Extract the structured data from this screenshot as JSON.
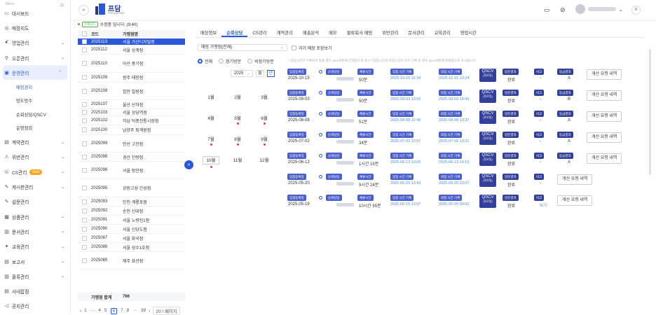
{
  "sidebar": {
    "menu_label": "Menu",
    "items": [
      {
        "label": "대시보드",
        "icon": "monitor-icon",
        "glyph": "▭",
        "chev": ""
      },
      {
        "label": "매장지도",
        "icon": "map-pin-icon",
        "glyph": "◎",
        "chev": ""
      },
      {
        "label": "영업관리",
        "icon": "people-icon",
        "glyph": "ꗃ",
        "chev": "⌄"
      },
      {
        "label": "오픈관리",
        "icon": "location-icon",
        "glyph": "⚲",
        "chev": "⌄"
      },
      {
        "label": "운영관리",
        "icon": "store-icon",
        "glyph": "▣",
        "chev": "⌃"
      }
    ],
    "sub_items": [
      "매장관리",
      "방도방수",
      "순회상담/QSCV",
      "운영점검"
    ],
    "items2": [
      {
        "label": "계약관리",
        "icon": "contract-icon",
        "glyph": "▤",
        "chev": "⌄"
      },
      {
        "label": "위반관리",
        "icon": "warning-icon",
        "glyph": "⚠",
        "chev": "⌄"
      },
      {
        "label": "CS관리",
        "icon": "cs-icon",
        "glyph": "☏",
        "chev": "⌄",
        "badge": "New"
      },
      {
        "label": "게시판관리",
        "icon": "edit-icon",
        "glyph": "✎",
        "chev": "⌄"
      },
      {
        "label": "설문관리",
        "icon": "survey-icon",
        "glyph": "✎",
        "chev": ""
      },
      {
        "label": "상품관리",
        "icon": "product-icon",
        "glyph": "▦",
        "chev": "⌄"
      },
      {
        "label": "문서관리",
        "icon": "document-icon",
        "glyph": "▥",
        "chev": "⌄"
      },
      {
        "label": "교육관리",
        "icon": "education-icon",
        "glyph": "✦",
        "chev": "⌄"
      },
      {
        "label": "보고서",
        "icon": "report-icon",
        "glyph": "▤",
        "chev": "⌄"
      },
      {
        "label": "물류관리",
        "icon": "logistics-icon",
        "glyph": "▥",
        "chev": "⌄"
      },
      {
        "label": "사내팝점",
        "icon": "shop-icon",
        "glyph": "▤",
        "chev": ""
      },
      {
        "label": "공지관리",
        "icon": "notice-icon",
        "glyph": "◁",
        "chev": ""
      }
    ]
  },
  "topbar": {
    "logo_text": "프담",
    "logo_sub": "FRDAM ERP"
  },
  "stores": {
    "mod_badge": "수정모드",
    "mod_text": "수정중 입니다. (9:40)",
    "col_code": "코드",
    "col_name": "가맹점명",
    "rows": [
      [
        "2025113",
        "서울 가산디지털점"
      ],
      [
        "2025112",
        "서울 상계점"
      ],
      [
        "2025110",
        "아산 풍기점"
      ],
      [
        "2025109",
        "원주 태장점"
      ],
      [
        "2025108",
        "합안 칠원점"
      ],
      [
        "2025107",
        "울산 산하점"
      ],
      [
        "2025103",
        "서울 상당역점"
      ],
      [
        "2025102",
        "하남 덕풍전통시장점"
      ],
      [
        "2025100",
        "남양주 퇴계원점"
      ],
      [
        "2025099",
        "안산 고잔점"
      ],
      [
        "2025098",
        "경산 진량점"
      ],
      [
        "2025096",
        "서울 장안점"
      ],
      [
        "2025095",
        "강원고성 간성점"
      ],
      [
        "2025093",
        "인천 계룡포점"
      ],
      [
        "2025092",
        "순천 신대점"
      ],
      [
        "2025091",
        "서울 노량진1점"
      ],
      [
        "2025090",
        "서울 신당도점"
      ],
      [
        "2025087",
        "서울 화곡점"
      ],
      [
        "2025086",
        "서울 성수1호점"
      ],
      [
        "2025085",
        "제주 표선점"
      ]
    ],
    "footer_label": "가맹점 합계",
    "footer_value": "766"
  },
  "pager": {
    "pages": [
      "1",
      "···",
      "4",
      "5",
      "6",
      "7",
      "8",
      "···",
      "39"
    ],
    "size": "20 / 페이지"
  },
  "tabs": [
    "매장정보",
    "순회상담",
    "CS관리",
    "계약관리",
    "매출분석",
    "메모",
    "물류회사 매핑",
    "위반관리",
    "문서관리",
    "교육관리",
    "영업시간"
  ],
  "filter": {
    "select": "매핑 가맹점(전체)",
    "past": "과거 매장 포함보기",
    "radios": [
      "전체",
      "정기방문",
      "비정기방문"
    ],
    "year": "2025",
    "btn_month": "월",
    "btn_year": "년"
  },
  "months": [
    "1월",
    "2월",
    "3월",
    "4월",
    "5월",
    "6월",
    "7월",
    "8월",
    "9월",
    "10월",
    "11월",
    "12월"
  ],
  "note": "* 입점시간만 기록되어 있을 경우 qscv버튼에 진행중으로 표시 / 입점시간과 퇴점시간이 모두 기록 된 경우 qscv버튼에 완료됨으로 표시됩니다.",
  "visit_labels": {
    "date": "입점등록일",
    "staff": "순회담당",
    "stay": "체류시간",
    "in": "입점 시간 기록",
    "out": "퇴점 시간 기록",
    "result": "방문결과",
    "memo": "비고",
    "grade": "등급결과",
    "qscv": "QSCV",
    "qscv_sub": "(완료됨)",
    "improve": "개선 요청 내역"
  },
  "visits": [
    {
      "date": "2025-10-15",
      "stay": "50분",
      "in": "2025-10-15 12:34",
      "out": "2025-10-15 13:24",
      "result": "완료",
      "memo": "-",
      "grade": "A"
    },
    {
      "date": "2025-09-03",
      "stay": "50분",
      "in": "2025-09-03 13:55",
      "out": "2025-09-03 14:45",
      "result": "완료",
      "memo": "-",
      "grade": "B"
    },
    {
      "date": "2025-08-08",
      "stay": "51분",
      "in": "2025-08-08 12:46",
      "out": "2025-08-08 13:37",
      "result": "완료",
      "memo": "-",
      "grade": "A"
    },
    {
      "date": "2025-07-02",
      "stay": "34분",
      "in": "2025-07-02 12:57",
      "out": "2025-07-02 13:31",
      "result": "완료",
      "memo": "-",
      "grade": "A"
    },
    {
      "date": "2025-06-13",
      "stay": "1시간 15분",
      "in": "2025-06-13 13:00",
      "out": "2025-06-13 14:15",
      "result": "완료",
      "memo": "-",
      "grade": "A"
    },
    {
      "date": "2025-05-20",
      "stay": "9시간 24분",
      "in": "2025-05-20 13:43",
      "out": "2025-05-20 23:07",
      "result": "완료",
      "memo": "-",
      "grade": ""
    },
    {
      "date": "2025-05-19",
      "stay": "10시간 55분",
      "in": "2025-05-19 13:07",
      "out": "2025-05-20 00:02",
      "result": "완료",
      "memo": "보기",
      "grade": ""
    }
  ]
}
